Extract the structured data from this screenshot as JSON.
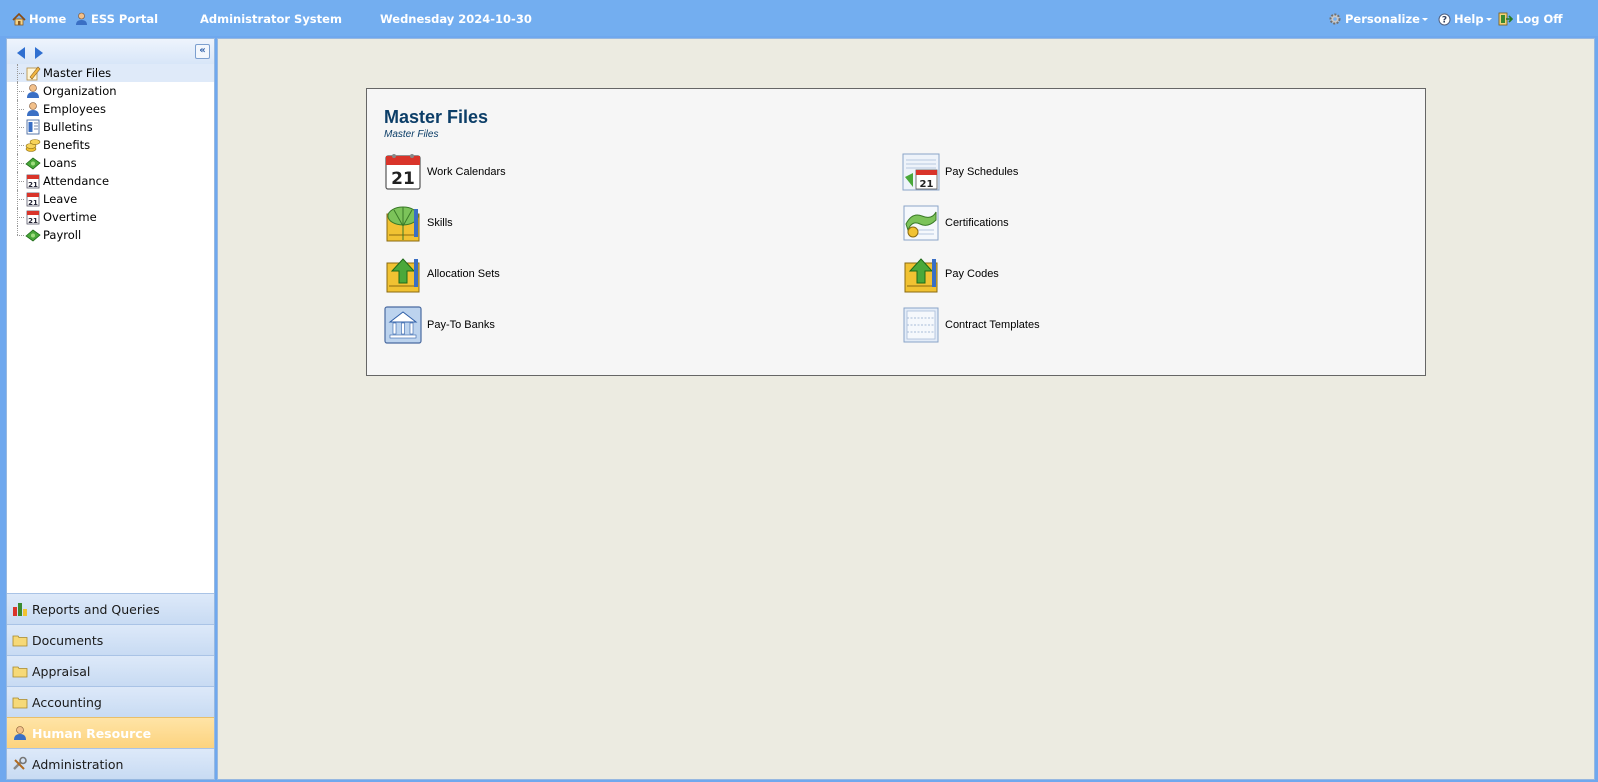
{
  "topbar": {
    "home": "Home",
    "ess_portal": "ESS Portal",
    "system": "Administrator System",
    "date": "Wednesday 2024-10-30",
    "personalize": "Personalize",
    "help": "Help",
    "logoff": "Log Off"
  },
  "tree": {
    "items": [
      {
        "label": "Master Files",
        "icon": "notebook-pencil-icon"
      },
      {
        "label": "Organization",
        "icon": "person-icon"
      },
      {
        "label": "Employees",
        "icon": "person-icon"
      },
      {
        "label": "Bulletins",
        "icon": "bulletin-icon"
      },
      {
        "label": "Benefits",
        "icon": "coins-icon"
      },
      {
        "label": "Loans",
        "icon": "money-icon"
      },
      {
        "label": "Attendance",
        "icon": "calendar-icon"
      },
      {
        "label": "Leave",
        "icon": "calendar-icon"
      },
      {
        "label": "Overtime",
        "icon": "calendar-icon"
      },
      {
        "label": "Payroll",
        "icon": "money-icon"
      }
    ]
  },
  "accordion": {
    "items": [
      {
        "label": "Reports and Queries",
        "icon": "reports-icon"
      },
      {
        "label": "Documents",
        "icon": "folder-icon"
      },
      {
        "label": "Appraisal",
        "icon": "folder-icon"
      },
      {
        "label": "Accounting",
        "icon": "folder-icon"
      },
      {
        "label": "Human Resource",
        "icon": "person-icon"
      },
      {
        "label": "Administration",
        "icon": "tools-icon"
      }
    ]
  },
  "main": {
    "title": "Master Files",
    "subtitle": "Master Files",
    "items": [
      {
        "label": "Work Calendars",
        "icon": "calendar-21-icon"
      },
      {
        "label": "Pay Schedules",
        "icon": "pay-schedule-icon"
      },
      {
        "label": "Skills",
        "icon": "skills-icon"
      },
      {
        "label": "Certifications",
        "icon": "certificate-icon"
      },
      {
        "label": "Allocation Sets",
        "icon": "allocation-icon"
      },
      {
        "label": "Pay Codes",
        "icon": "pay-codes-icon"
      },
      {
        "label": "Pay-To Banks",
        "icon": "bank-icon"
      },
      {
        "label": "Contract Templates",
        "icon": "contract-icon"
      }
    ]
  },
  "colors": {
    "topbar": "#73aef0",
    "title": "#0c3e68",
    "active_accordion": "#fcd37f",
    "main_bg": "#ecebe1"
  }
}
